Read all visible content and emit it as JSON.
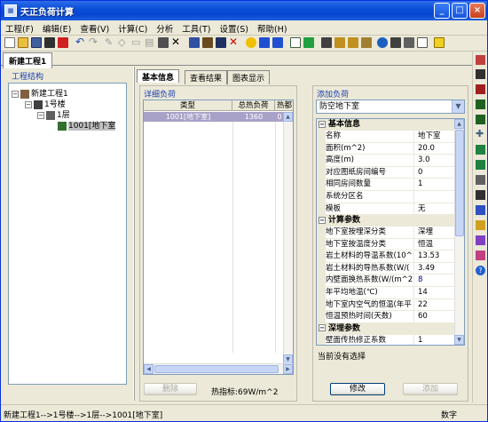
{
  "window": {
    "title": "天正负荷计算",
    "minimize": "_",
    "maximize": "□",
    "close": "×"
  },
  "menu": [
    "工程(F)",
    "编辑(E)",
    "查看(V)",
    "计算(C)",
    "分析",
    "工具(T)",
    "设置(S)",
    "帮助(H)"
  ],
  "doc_tab": "新建工程1",
  "left_panel": {
    "title": "工程结构",
    "tree": [
      {
        "label": "新建工程1",
        "icon": "project-icon"
      },
      {
        "label": "1号楼",
        "icon": "building-icon"
      },
      {
        "label": "1层",
        "icon": "floor-icon"
      },
      {
        "label": "1001[地下室",
        "icon": "room-icon"
      }
    ]
  },
  "sub_tabs": [
    "基本信息",
    "查看结果",
    "图表显示"
  ],
  "detail": {
    "title": "详细负荷",
    "columns": [
      "类型",
      "总热负荷",
      "热都"
    ],
    "row": [
      "1001[地下室]",
      "1360",
      "0"
    ],
    "delete_button": "删除",
    "heat_index": "热指标:69W/m^2"
  },
  "add_load": {
    "title": "添加负荷",
    "selected_type": "防空地下室",
    "categories": [
      {
        "name": "基本信息",
        "rows": [
          {
            "name": "名称",
            "value": "地下室"
          },
          {
            "name": "面积(m^2)",
            "value": "20.0"
          },
          {
            "name": "高度(m)",
            "value": "3.0"
          },
          {
            "name": "对应图纸房间编号",
            "value": "0"
          },
          {
            "name": "相同房间数量",
            "value": "1"
          },
          {
            "name": "系统分区名",
            "value": ""
          },
          {
            "name": "模板",
            "value": "无"
          }
        ]
      },
      {
        "name": "计算参数",
        "rows": [
          {
            "name": "地下室按埋深分类",
            "value": "深埋"
          },
          {
            "name": "地下室按温度分类",
            "value": "恒温"
          },
          {
            "name": "岩土材料的导温系数(10^",
            "value": "13.53"
          },
          {
            "name": "岩土材料的导热系数(W/(",
            "value": "3.49"
          },
          {
            "name": "内壁面换热系数(W/(m^2",
            "value": "8"
          },
          {
            "name": "年平均地温(℃)",
            "value": "14"
          },
          {
            "name": "地下室内空气的恒温(年平",
            "value": "22"
          },
          {
            "name": "恒温预热时间(天数)",
            "value": "60"
          }
        ]
      },
      {
        "name": "深埋参数",
        "rows": [
          {
            "name": "壁面传热修正系数",
            "value": "1"
          }
        ]
      }
    ],
    "status": "当前没有选择",
    "modify_button": "修改",
    "add_button": "添加"
  },
  "statusbar": {
    "path": "新建工程1-->1号楼-->1层-->1001[地下室]",
    "mode": "数字"
  }
}
